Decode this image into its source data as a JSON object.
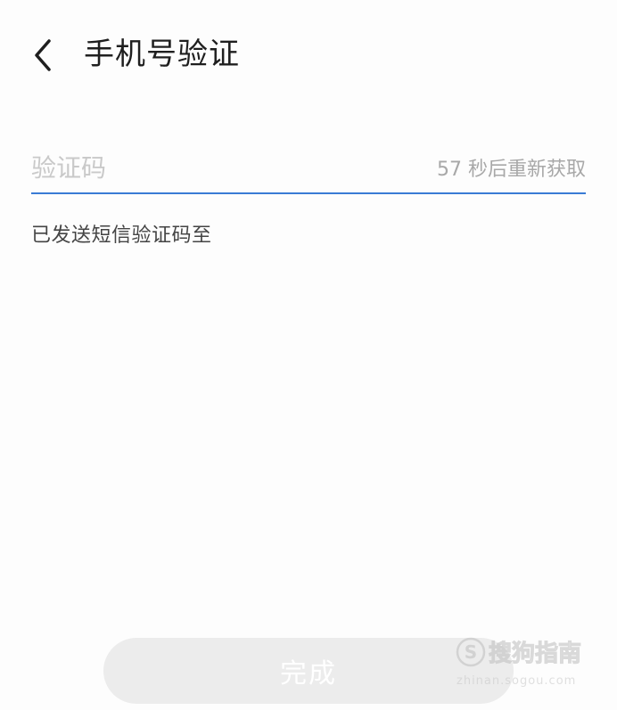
{
  "header": {
    "back_icon": "chevron-left-icon",
    "title": "手机号验证"
  },
  "verification": {
    "code_placeholder": "验证码",
    "code_value": "",
    "resend_countdown": "57 秒后重新获取",
    "sent_hint": "已发送短信验证码至"
  },
  "footer": {
    "done_label": "完成"
  },
  "watermark": {
    "brand": "搜狗指南",
    "url": "zhinan.sogou.com"
  },
  "colors": {
    "accent": "#3a7bd5",
    "disabled_button": "#ececec",
    "placeholder": "#c9c9c9"
  }
}
